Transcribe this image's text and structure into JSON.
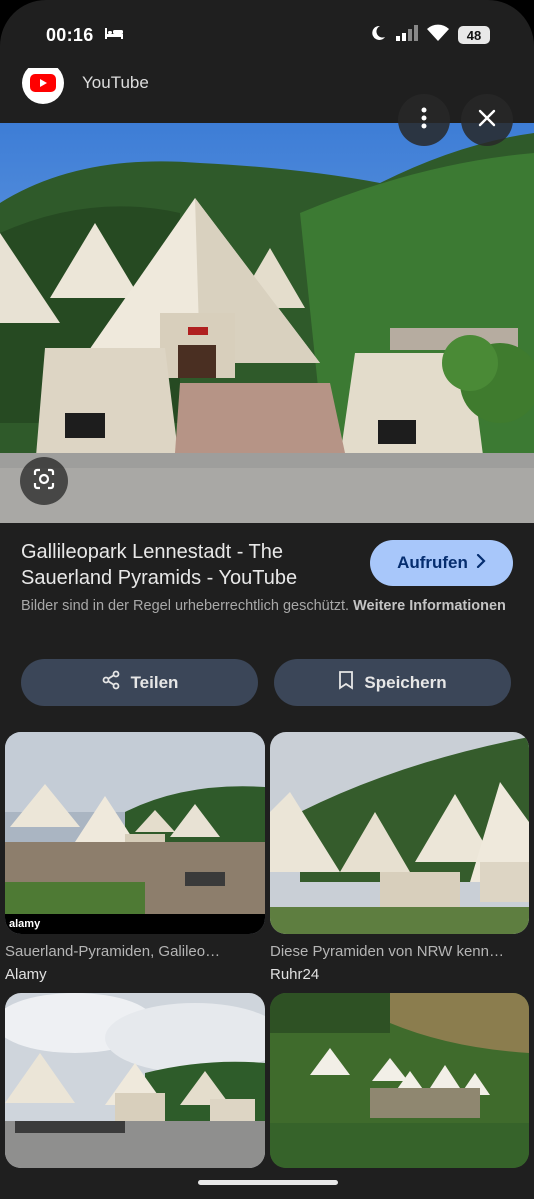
{
  "status_bar": {
    "time": "00:16",
    "battery": "48"
  },
  "header": {
    "source_name": "YouTube"
  },
  "result": {
    "title": "Gallileopark Lennestadt - The Sauerland Pyramids - YouTube",
    "visit_label": "Aufrufen",
    "copyright_text": "Bilder sind in der Regel urheberrechtlich geschützt.",
    "copyright_link": "Weitere Informationen",
    "share_label": "Teilen",
    "save_label": "Speichern"
  },
  "related": [
    {
      "caption": "Sauerland-Pyramiden, Galileo…",
      "source": "Alamy",
      "watermark": "alamy"
    },
    {
      "caption": "Diese Pyramiden von NRW kenn…",
      "source": "Ruhr24"
    },
    {
      "caption": "",
      "source": ""
    },
    {
      "caption": "",
      "source": ""
    }
  ],
  "icons": {
    "bed": "bed-icon",
    "moon": "moon-icon",
    "signal": "signal-icon",
    "wifi": "wifi-icon",
    "more": "more-vertical-icon",
    "close": "close-icon",
    "lens": "lens-icon",
    "share": "share-icon",
    "bookmark": "bookmark-icon",
    "chevron": "chevron-right-icon"
  },
  "colors": {
    "background": "#1f1f1f",
    "accent_button": "#a8c7fa",
    "secondary_button": "#3b4658",
    "youtube_red": "#ff0000"
  }
}
